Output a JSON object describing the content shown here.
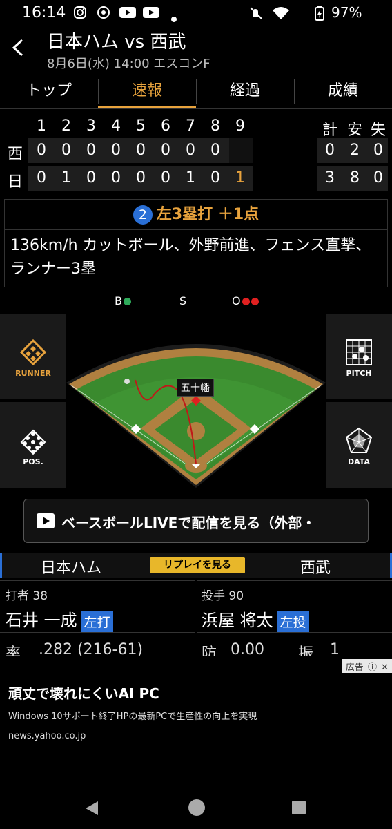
{
  "status_bar": {
    "time": "16:14",
    "battery": "97%"
  },
  "header": {
    "title": "日本ハム vs 西武",
    "subtitle": "8月6日(水) 14:00 エスコンF"
  },
  "tabs": [
    {
      "label": "トップ"
    },
    {
      "label": "速報",
      "active": true
    },
    {
      "label": "経過"
    },
    {
      "label": "成績"
    }
  ],
  "scoreboard": {
    "innings": [
      "1",
      "2",
      "3",
      "4",
      "5",
      "6",
      "7",
      "8",
      "9"
    ],
    "totals_headers": [
      "計",
      "安",
      "失"
    ],
    "rows": [
      {
        "team": "西",
        "runs": [
          "0",
          "0",
          "0",
          "0",
          "0",
          "0",
          "0",
          "0",
          ""
        ],
        "totals": [
          "0",
          "2",
          "0"
        ]
      },
      {
        "team": "日",
        "runs": [
          "0",
          "1",
          "0",
          "0",
          "0",
          "0",
          "1",
          "0",
          "1"
        ],
        "totals": [
          "3",
          "8",
          "0"
        ]
      }
    ]
  },
  "play": {
    "number": "2",
    "result": "左3塁打 ＋1点",
    "description": "136km/h カットボール、外野前進、フェンス直撃、ランナー3塁"
  },
  "count": {
    "b_label": "B",
    "s_label": "S",
    "o_label": "O",
    "balls": 1,
    "strikes": 0,
    "outs": 2
  },
  "field": {
    "runner_on_third": "五十幡",
    "buttons": {
      "runner": "RUNNER",
      "pitch": "PITCH",
      "pos": "POS.",
      "data": "DATA"
    }
  },
  "live_banner": {
    "text": "ベースボールLIVEで配信を見る（外部・"
  },
  "teams_bar": {
    "home": "日本ハム",
    "away": "西武",
    "replay": "リプレイを見る"
  },
  "batter": {
    "label": "打者 38",
    "name": "石井 一成",
    "hand": "左打",
    "stat_label": "率",
    "stat_value": ".282 (216-61)"
  },
  "pitcher": {
    "label": "投手 90",
    "name": "浜屋 将太",
    "hand": "左投",
    "stat1_label": "防",
    "stat1_value": "0.00",
    "stat2_label": "振",
    "stat2_value": "1"
  },
  "ad": {
    "tag": "広告",
    "title": "頑丈で壊れにくいAI PC",
    "description": "Windows 10サポート終了HPの最新PCで生産性の向上を実現",
    "url": "news.yahoo.co.jp"
  },
  "colors": {
    "accent": "#e8a33d",
    "blue": "#2a6fd6",
    "field_green": "#3a8a2e"
  }
}
